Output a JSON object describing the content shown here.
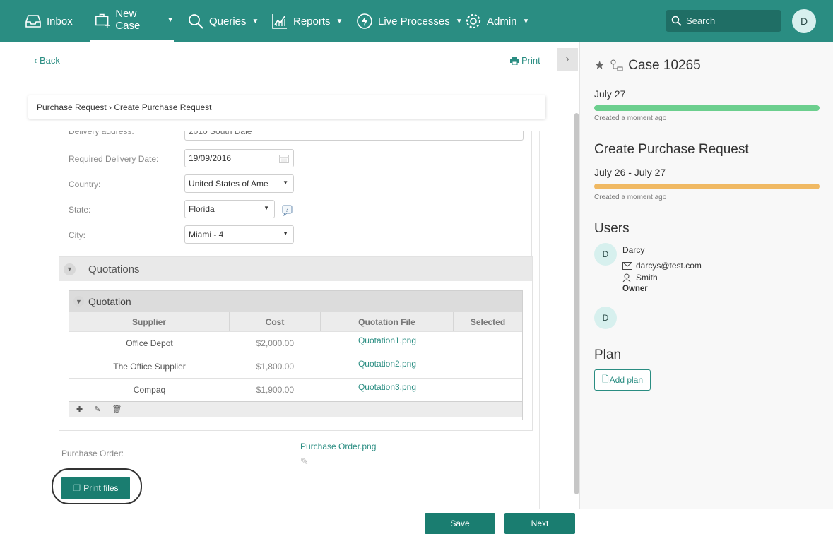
{
  "colors": {
    "brand": "#2a8d82",
    "button": "#1a7d70",
    "progress_done": "#6ccf8e",
    "progress_warn": "#f0b963"
  },
  "nav": [
    {
      "label": "Inbox",
      "icon": "inbox-icon"
    },
    {
      "label": "New Case",
      "icon": "briefcase-plus-icon"
    },
    {
      "label": "Queries",
      "icon": "search-icon"
    },
    {
      "label": "Reports",
      "icon": "chart-icon"
    },
    {
      "label": "Live Processes",
      "icon": "bolt-icon"
    },
    {
      "label": "Admin",
      "icon": "gear-icon"
    }
  ],
  "search": {
    "placeholder": "Search"
  },
  "user_initial": "D",
  "main": {
    "back": "Back",
    "print": "Print",
    "breadcrumb": "Purchase Request › Create Purchase Request",
    "address_label": "Delivery address:",
    "address_value": "2010 South Dale",
    "fields": [
      {
        "label": "Required Delivery Date:",
        "value": "19/09/2016"
      },
      {
        "label": "Country:",
        "value": "United States of Ame"
      },
      {
        "label": "State:",
        "value": "Florida"
      },
      {
        "label": "City:",
        "value": "Miami - 4"
      }
    ],
    "quotations_title": "Quotations",
    "quotation_title": "Quotation",
    "columns": [
      "Supplier",
      "Cost",
      "Quotation File",
      "Selected"
    ],
    "rows": [
      {
        "supplier": "Office Depot",
        "cost": "$2,000.00",
        "file": "Quotation1.png"
      },
      {
        "supplier": "The Office Supplier",
        "cost": "$1,800.00",
        "file": "Quotation2.png"
      },
      {
        "supplier": "Compaq",
        "cost": "$1,900.00",
        "file": "Quotation3.png"
      }
    ],
    "po_label": "Purchase Order:",
    "po_file": "Purchase Order.png",
    "print_files": "Print files"
  },
  "side": {
    "case_title": "Case 10265",
    "date1": "July 27",
    "created1": "Created a moment ago",
    "activity": "Create Purchase Request",
    "date2": "July 26 - July 27",
    "created2": "Created a moment ago",
    "users_title": "Users",
    "user_initial": "D",
    "user_name": "Darcy",
    "user_email": "darcys@test.com",
    "user_last": "Smith",
    "user_role": "Owner",
    "user2_initial": "D",
    "plan_title": "Plan",
    "add_plan": "Add plan"
  },
  "footer": {
    "save": "Save",
    "next": "Next"
  }
}
